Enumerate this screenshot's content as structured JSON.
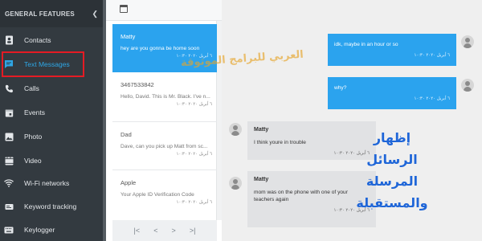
{
  "sidebar": {
    "header": "GENERAL FEATURES",
    "items": [
      {
        "label": "Contacts",
        "icon": "contacts-icon"
      },
      {
        "label": "Text Messages",
        "icon": "message-icon",
        "active": true
      },
      {
        "label": "Calls",
        "icon": "phone-icon"
      },
      {
        "label": "Events",
        "icon": "calendar-icon"
      },
      {
        "label": "Photo",
        "icon": "photo-icon"
      },
      {
        "label": "Video",
        "icon": "video-icon"
      },
      {
        "label": "Wi-Fi networks",
        "icon": "wifi-icon"
      },
      {
        "label": "Keyword tracking",
        "icon": "keyword-icon"
      },
      {
        "label": "Keylogger",
        "icon": "keyboard-icon"
      }
    ]
  },
  "conversations": [
    {
      "name": "Matty",
      "preview": "hey are you gonna be home soon",
      "date": "٦ أبريل ٢٠٢٠ ١٠:٣٠"
    },
    {
      "name": "3467533842",
      "preview": "Hello, David. This is Mr. Black. I've n...",
      "date": "٦ أبريل ٢٠٢٠ ١٠:٣٠"
    },
    {
      "name": "Dad",
      "preview": "Dave, can you pick up Matt from sc...",
      "date": "٦ أبريل ٢٠٢٠ ١٠:٣٠"
    },
    {
      "name": "Apple",
      "preview": "Your Apple ID Verification Code",
      "date": "٦ أبريل ٢٠٢٠ ١٠:٣٠"
    }
  ],
  "pager": [
    "|<",
    "<",
    ">",
    ">|"
  ],
  "messages": [
    {
      "direction": "out",
      "text": "idk, maybe in an hour or so",
      "date": "٦ أبريل ٢٠٢٠ ١٠:٣٠"
    },
    {
      "direction": "out",
      "text": "why?",
      "date": "٦ أبريل ٢٠٢٠ ١٠:٣٠"
    },
    {
      "direction": "in",
      "sender": "Matty",
      "text": "I think youre in trouble",
      "date": "٦ أبريل ٢٠٢٠ ١٠:٣٠"
    },
    {
      "direction": "in",
      "sender": "Matty",
      "text": "mom was on the phone with one of your teachers again",
      "date": "٦ أبريل ٢٠٢٠ ١٠:٣٠"
    }
  ],
  "watermark": "العربي للبرامج الموثوقة",
  "overlay_lines": [
    "إظهار الرسائل",
    "المرسلة",
    "والمستقبلة"
  ],
  "colors": {
    "sidebar": "#333a40",
    "accent": "#2ba3ee",
    "highlight_box": "#e51b24",
    "overlay_text": "#1f66d8",
    "watermark": "#e6a52a"
  }
}
